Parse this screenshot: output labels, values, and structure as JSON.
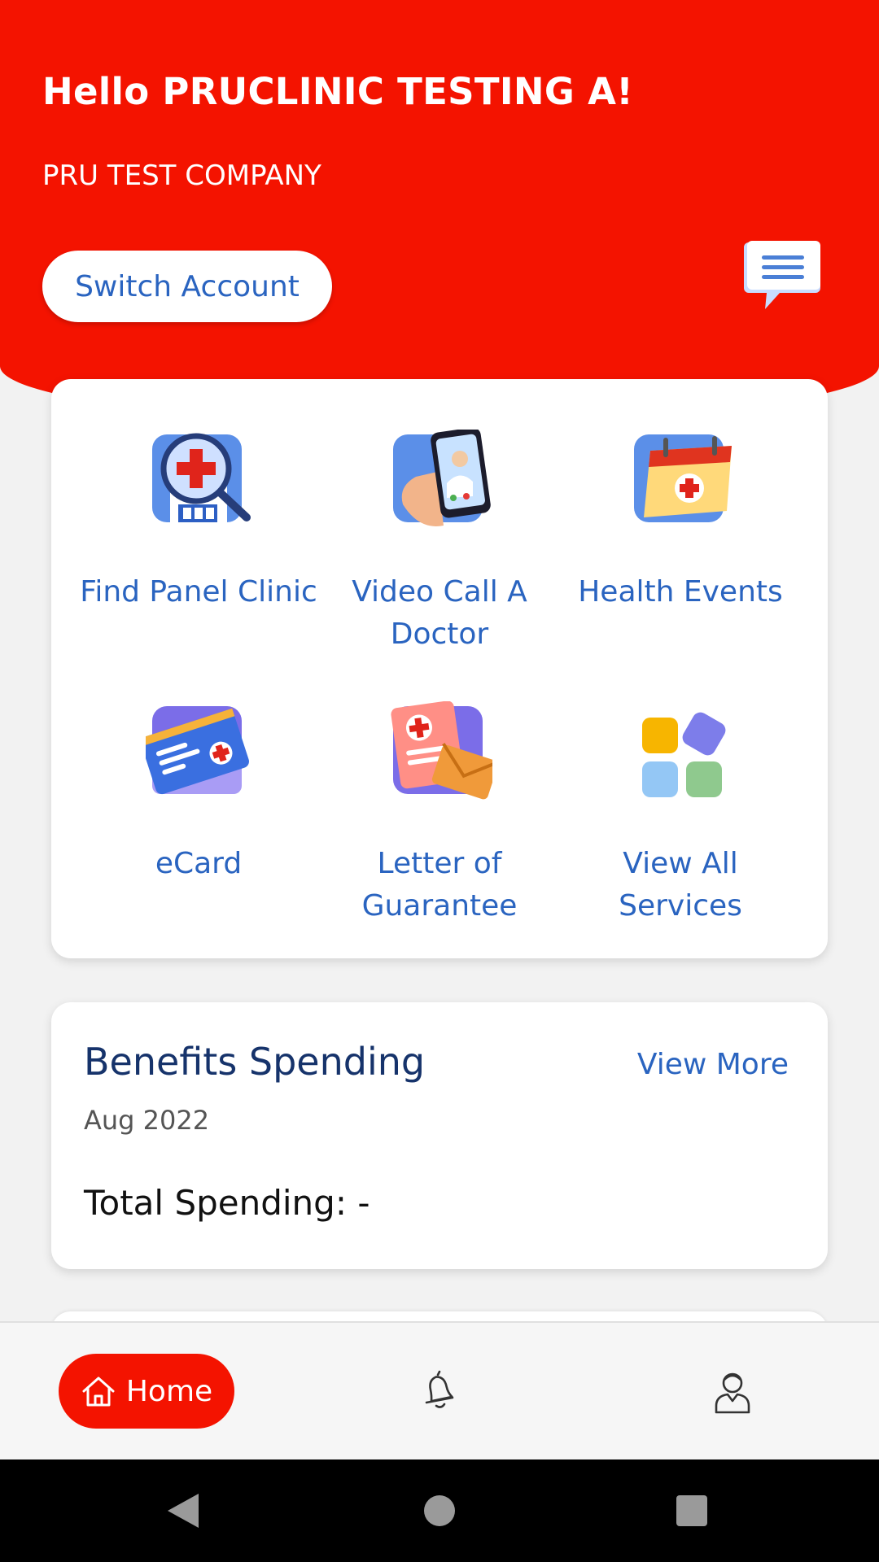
{
  "header": {
    "greeting": "Hello PRUCLINIC TESTING A!",
    "company": "PRU TEST COMPANY",
    "switch_account_label": "Switch Account",
    "chat_icon": "chat-bubble-icon"
  },
  "services": [
    {
      "label": "Find Panel Clinic",
      "icon": "clinic-search-icon"
    },
    {
      "label": "Video Call A Doctor",
      "icon": "video-call-doctor-icon"
    },
    {
      "label": "Health Events",
      "icon": "calendar-health-icon"
    },
    {
      "label": "eCard",
      "icon": "ecard-icon"
    },
    {
      "label": "Letter of Guarantee",
      "icon": "letter-guarantee-icon"
    },
    {
      "label": "View All Services",
      "icon": "view-all-grid-icon"
    }
  ],
  "benefits": {
    "title": "Benefits Spending",
    "view_more": "View More",
    "period": "Aug 2022",
    "total": "Total Spending: -"
  },
  "bottom_nav": {
    "home_label": "Home",
    "items": [
      "home-icon",
      "bell-icon",
      "profile-icon"
    ]
  },
  "colors": {
    "brand_red": "#f41300",
    "link_blue": "#2a64c0",
    "title_navy": "#16336b"
  }
}
